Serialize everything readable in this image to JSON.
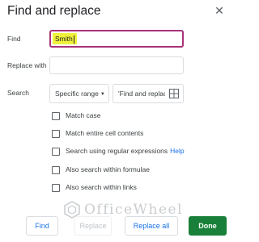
{
  "dialog": {
    "title": "Find and replace",
    "close_icon": "close-icon"
  },
  "find": {
    "label": "Find",
    "value": "Smith"
  },
  "replace_with": {
    "label": "Replace with",
    "value": ""
  },
  "search": {
    "label": "Search",
    "scope": "Specific range",
    "range_value": "'Find and replac",
    "range_icon": "grid-icon"
  },
  "options": [
    {
      "label": "Match case",
      "checked": false
    },
    {
      "label": "Match entire cell contents",
      "checked": false
    },
    {
      "label": "Search using regular expressions",
      "checked": false
    },
    {
      "label": "Also search within formulae",
      "checked": false
    },
    {
      "label": "Also search within links",
      "checked": false
    }
  ],
  "help_link": "Help",
  "buttons": {
    "find": "Find",
    "replace": "Replace",
    "replace_all": "Replace all",
    "done": "Done"
  },
  "watermark": {
    "text": "OfficeWheel"
  },
  "colors": {
    "accent_green": "#188038",
    "link_blue": "#1a73e8",
    "focus_border": "#a8327a",
    "highlight": "#f0f13b"
  }
}
